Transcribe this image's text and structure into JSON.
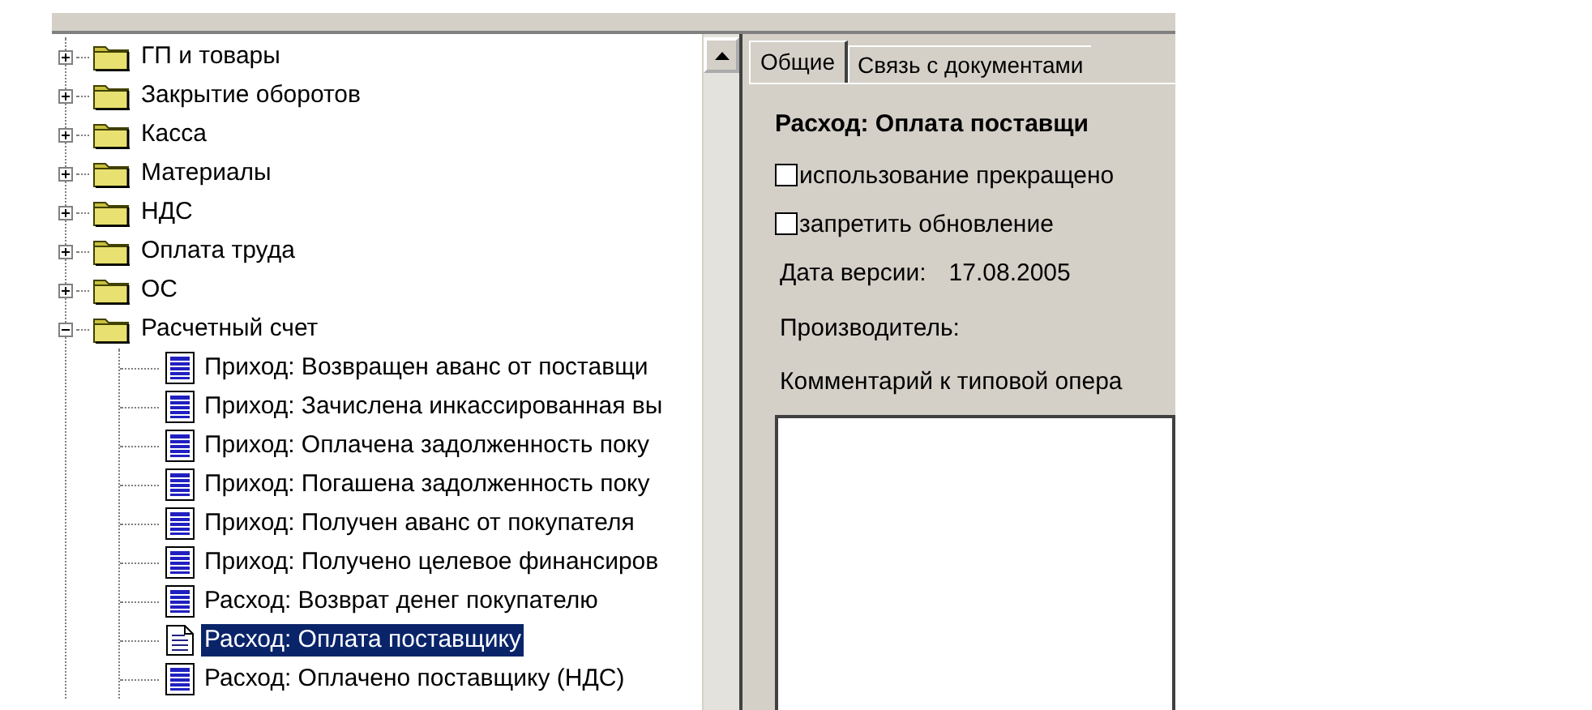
{
  "tree": {
    "items": [
      {
        "kind": "folder",
        "label": "ГП и товары",
        "expanded": false,
        "selected": false
      },
      {
        "kind": "folder",
        "label": "Закрытие оборотов",
        "expanded": false,
        "selected": false
      },
      {
        "kind": "folder",
        "label": "Касса",
        "expanded": false,
        "selected": false
      },
      {
        "kind": "folder",
        "label": "Материалы",
        "expanded": false,
        "selected": false
      },
      {
        "kind": "folder",
        "label": "НДС",
        "expanded": false,
        "selected": false
      },
      {
        "kind": "folder",
        "label": "Оплата труда",
        "expanded": false,
        "selected": false
      },
      {
        "kind": "folder",
        "label": "ОС",
        "expanded": false,
        "selected": false
      },
      {
        "kind": "folder",
        "label": "Расчетный счет",
        "expanded": true,
        "selected": false,
        "children": [
          {
            "kind": "operation",
            "label": "Приход: Возвращен аванс от поставщи",
            "selected": false
          },
          {
            "kind": "operation",
            "label": "Приход: Зачислена инкассированная вы",
            "selected": false
          },
          {
            "kind": "operation",
            "label": "Приход: Оплачена задолженность поку",
            "selected": false
          },
          {
            "kind": "operation",
            "label": "Приход: Погашена задолженность поку",
            "selected": false
          },
          {
            "kind": "operation",
            "label": "Приход: Получен аванс от покупателя",
            "selected": false
          },
          {
            "kind": "operation",
            "label": "Приход: Получено целевое финансиров",
            "selected": false
          },
          {
            "kind": "operation",
            "label": "Расход: Возврат денег покупателю",
            "selected": false
          },
          {
            "kind": "operation",
            "label": "Расход: Оплата поставщику",
            "selected": true
          },
          {
            "kind": "operation",
            "label": "Расход: Оплачено поставщику (НДС)",
            "selected": false
          }
        ]
      }
    ]
  },
  "tabs": [
    {
      "label": "Общие",
      "selected": true
    },
    {
      "label": "Связь с документами",
      "selected": false
    }
  ],
  "details": {
    "heading": "Расход: Оплата поставщи",
    "checkboxes": [
      {
        "label": "использование прекращено",
        "checked": false
      },
      {
        "label": "запретить обновление",
        "checked": false
      }
    ],
    "version_date": {
      "label": "Дата версии:",
      "value": "17.08.2005"
    },
    "producer": {
      "label": "Производитель:"
    },
    "comment": {
      "label": "Комментарий к типовой опера"
    }
  }
}
